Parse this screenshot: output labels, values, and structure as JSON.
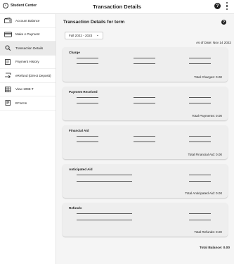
{
  "header": {
    "back_label": "Student Center",
    "title": "Transaction Details",
    "help_label": "?"
  },
  "sidebar": {
    "items": [
      {
        "label": "Account Balance",
        "icon": "wallet-icon"
      },
      {
        "label": "Make A Payment",
        "icon": "payment-card-icon"
      },
      {
        "label": "Transaction Details",
        "icon": "search-icon",
        "active": true
      },
      {
        "label": "Payment History",
        "icon": "history-icon"
      },
      {
        "label": "eRefund (Direct Deposit)",
        "icon": "refund-icon"
      },
      {
        "label": "View 1098-T",
        "icon": "tax-form-icon"
      },
      {
        "label": "EForms",
        "icon": "form-icon"
      }
    ]
  },
  "main": {
    "title": "Transaction Details for term",
    "info_label": "?",
    "term_value": "Fall 2022 - 2023",
    "as_of": "As of Date: Nov 14 2022",
    "sections": [
      {
        "title": "Charge",
        "total": "Total Charges: 0.00"
      },
      {
        "title": "Payment Received",
        "total": "Total Payments: 0.00"
      },
      {
        "title": "Financial Aid",
        "total": "Total Financial Aid: 0.00"
      },
      {
        "title": "Anticipated Aid",
        "total": "Total Anticipated Aid: 0.00"
      },
      {
        "title": "Refunds",
        "total": "Total Refunds: 0.00"
      }
    ],
    "grand_total": "Total Balance: 0.00"
  }
}
